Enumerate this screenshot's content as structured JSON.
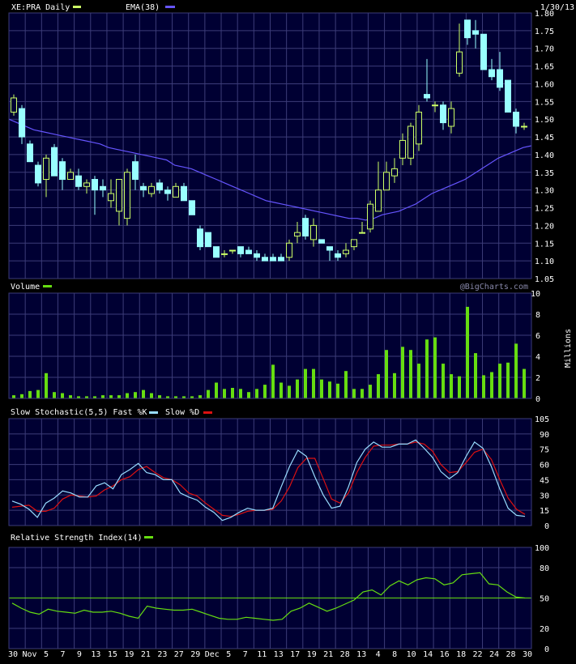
{
  "colors": {
    "background": "#000000",
    "panel": "#000033",
    "grid": "#3c3c78",
    "candle_up": "#ccff66",
    "candle_down": "#99ffff",
    "ema": "#6655ff",
    "volume": "#66dd11",
    "fast_k": "#99ddff",
    "slow_d": "#dd1111",
    "rsi": "#66dd11",
    "text": "#ffffff"
  },
  "header": {
    "symbol_label": "XE:PRA Daily",
    "ema_label": "EMA(38)",
    "date": "1/30/13"
  },
  "volume_panel": {
    "title": "Volume",
    "watermark": "@BigCharts.com",
    "unit": "Millions"
  },
  "stoch_panel": {
    "title": "Slow Stochastic(5,5) Fast %K",
    "slow_label": "Slow %D"
  },
  "rsi_panel": {
    "title": "Relative Strength Index(14)"
  },
  "x_axis": {
    "labels": [
      "30",
      "Nov",
      "5",
      "7",
      "9",
      "13",
      "15",
      "19",
      "21",
      "23",
      "27",
      "29",
      "Dec",
      "5",
      "7",
      "11",
      "13",
      "17",
      "19",
      "21",
      "28",
      "13",
      "4",
      "8",
      "10",
      "14",
      "16",
      "18",
      "22",
      "24",
      "28",
      "30"
    ]
  },
  "chart_data": [
    {
      "type": "candlestick",
      "ylim": [
        1.05,
        1.8
      ],
      "ytick_labels": [
        "1.80",
        "1.75",
        "1.70",
        "1.65",
        "1.60",
        "1.55",
        "1.50",
        "1.45",
        "1.40",
        "1.35",
        "1.30",
        "1.25",
        "1.20",
        "1.15",
        "1.10",
        "1.05"
      ],
      "ohlc": [
        [
          1.52,
          1.57,
          1.51,
          1.56
        ],
        [
          1.53,
          1.54,
          1.43,
          1.45
        ],
        [
          1.43,
          1.44,
          1.38,
          1.38
        ],
        [
          1.37,
          1.38,
          1.31,
          1.32
        ],
        [
          1.33,
          1.4,
          1.28,
          1.39
        ],
        [
          1.42,
          1.43,
          1.34,
          1.34
        ],
        [
          1.38,
          1.39,
          1.3,
          1.33
        ],
        [
          1.33,
          1.36,
          1.33,
          1.35
        ],
        [
          1.34,
          1.36,
          1.3,
          1.31
        ],
        [
          1.31,
          1.33,
          1.29,
          1.32
        ],
        [
          1.33,
          1.34,
          1.23,
          1.3
        ],
        [
          1.31,
          1.33,
          1.28,
          1.3
        ],
        [
          1.27,
          1.33,
          1.25,
          1.29
        ],
        [
          1.24,
          1.33,
          1.2,
          1.33
        ],
        [
          1.22,
          1.36,
          1.2,
          1.35
        ],
        [
          1.38,
          1.4,
          1.3,
          1.33
        ],
        [
          1.31,
          1.32,
          1.28,
          1.3
        ],
        [
          1.29,
          1.32,
          1.28,
          1.31
        ],
        [
          1.32,
          1.33,
          1.29,
          1.3
        ],
        [
          1.3,
          1.31,
          1.27,
          1.29
        ],
        [
          1.28,
          1.32,
          1.28,
          1.31
        ],
        [
          1.31,
          1.32,
          1.27,
          1.27
        ],
        [
          1.27,
          1.27,
          1.23,
          1.23
        ],
        [
          1.19,
          1.2,
          1.13,
          1.14
        ],
        [
          1.18,
          1.18,
          1.14,
          1.14
        ],
        [
          1.14,
          1.14,
          1.11,
          1.11
        ],
        [
          1.12,
          1.13,
          1.11,
          1.12
        ],
        [
          1.13,
          1.13,
          1.12,
          1.13
        ],
        [
          1.14,
          1.14,
          1.11,
          1.12
        ],
        [
          1.13,
          1.14,
          1.12,
          1.12
        ],
        [
          1.12,
          1.13,
          1.1,
          1.11
        ],
        [
          1.11,
          1.12,
          1.1,
          1.1
        ],
        [
          1.11,
          1.12,
          1.1,
          1.1
        ],
        [
          1.11,
          1.12,
          1.1,
          1.1
        ],
        [
          1.11,
          1.16,
          1.1,
          1.15
        ],
        [
          1.17,
          1.21,
          1.15,
          1.18
        ],
        [
          1.22,
          1.23,
          1.16,
          1.17
        ],
        [
          1.16,
          1.22,
          1.14,
          1.2
        ],
        [
          1.16,
          1.16,
          1.15,
          1.15
        ],
        [
          1.14,
          1.14,
          1.1,
          1.13
        ],
        [
          1.12,
          1.13,
          1.1,
          1.11
        ],
        [
          1.12,
          1.15,
          1.11,
          1.13
        ],
        [
          1.14,
          1.16,
          1.13,
          1.16
        ],
        [
          1.18,
          1.21,
          1.18,
          1.18
        ],
        [
          1.19,
          1.27,
          1.18,
          1.26
        ],
        [
          1.24,
          1.38,
          1.24,
          1.3
        ],
        [
          1.3,
          1.38,
          1.3,
          1.35
        ],
        [
          1.34,
          1.39,
          1.32,
          1.36
        ],
        [
          1.39,
          1.46,
          1.37,
          1.44
        ],
        [
          1.39,
          1.49,
          1.37,
          1.48
        ],
        [
          1.43,
          1.54,
          1.41,
          1.52
        ],
        [
          1.57,
          1.67,
          1.55,
          1.56
        ],
        [
          1.54,
          1.55,
          1.52,
          1.54
        ],
        [
          1.54,
          1.55,
          1.47,
          1.49
        ],
        [
          1.48,
          1.55,
          1.46,
          1.53
        ],
        [
          1.63,
          1.77,
          1.62,
          1.69
        ],
        [
          1.78,
          1.78,
          1.71,
          1.73
        ],
        [
          1.75,
          1.78,
          1.7,
          1.74
        ],
        [
          1.74,
          1.74,
          1.66,
          1.64
        ],
        [
          1.64,
          1.67,
          1.61,
          1.62
        ],
        [
          1.64,
          1.69,
          1.58,
          1.59
        ],
        [
          1.61,
          1.61,
          1.52,
          1.52
        ],
        [
          1.52,
          1.53,
          1.46,
          1.48
        ],
        [
          1.48,
          1.49,
          1.47,
          1.48
        ]
      ],
      "ema38": [
        1.5,
        1.49,
        1.48,
        1.47,
        1.465,
        1.46,
        1.455,
        1.45,
        1.445,
        1.44,
        1.435,
        1.43,
        1.42,
        1.415,
        1.41,
        1.405,
        1.4,
        1.395,
        1.39,
        1.385,
        1.37,
        1.365,
        1.36,
        1.35,
        1.34,
        1.33,
        1.32,
        1.31,
        1.3,
        1.29,
        1.28,
        1.27,
        1.265,
        1.26,
        1.255,
        1.25,
        1.245,
        1.24,
        1.235,
        1.23,
        1.225,
        1.22,
        1.22,
        1.215,
        1.22,
        1.23,
        1.235,
        1.24,
        1.25,
        1.26,
        1.275,
        1.29,
        1.3,
        1.31,
        1.32,
        1.33,
        1.345,
        1.36,
        1.375,
        1.39,
        1.4,
        1.41,
        1.42,
        1.425
      ]
    },
    {
      "type": "bar",
      "title": "Volume",
      "ylabel": "Millions",
      "ylim": [
        0,
        10
      ],
      "ytick_labels": [
        "10",
        "8",
        "6",
        "4",
        "2",
        "0"
      ],
      "values": [
        0.3,
        0.4,
        0.7,
        0.8,
        2.4,
        0.6,
        0.5,
        0.3,
        0.2,
        0.2,
        0.2,
        0.3,
        0.3,
        0.3,
        0.5,
        0.6,
        0.8,
        0.5,
        0.3,
        0.2,
        0.2,
        0.2,
        0.2,
        0.3,
        0.8,
        1.5,
        0.9,
        1.0,
        0.9,
        0.6,
        0.9,
        1.3,
        3.2,
        1.5,
        1.2,
        1.8,
        2.8,
        2.8,
        1.8,
        1.6,
        1.4,
        2.6,
        0.9,
        0.9,
        1.3,
        2.3,
        4.6,
        2.4,
        4.9,
        4.6,
        3.3,
        5.6,
        5.8,
        3.3,
        2.3,
        2.1,
        8.7,
        4.3,
        2.2,
        2.5,
        3.3,
        3.4,
        5.2,
        2.8
      ]
    },
    {
      "type": "line",
      "title": "Slow Stochastic(5,5)",
      "ylim": [
        0,
        105
      ],
      "ytick_labels": [
        "105",
        "90",
        "75",
        "60",
        "45",
        "30",
        "15",
        "0"
      ],
      "series": [
        {
          "name": "Fast %K",
          "values": [
            24,
            21,
            16,
            8,
            22,
            27,
            34,
            32,
            28,
            28,
            39,
            42,
            36,
            50,
            55,
            61,
            52,
            50,
            45,
            45,
            32,
            28,
            25,
            18,
            13,
            5,
            8,
            13,
            17,
            15,
            15,
            17,
            38,
            58,
            74,
            68,
            48,
            30,
            17,
            19,
            38,
            62,
            75,
            82,
            77,
            77,
            80,
            80,
            84,
            76,
            67,
            53,
            46,
            52,
            68,
            82,
            76,
            58,
            36,
            17,
            10,
            9
          ]
        },
        {
          "name": "Slow %D",
          "values": [
            18,
            19,
            20,
            14,
            14,
            17,
            26,
            30,
            29,
            28,
            29,
            35,
            39,
            45,
            48,
            55,
            58,
            52,
            47,
            45,
            40,
            32,
            29,
            22,
            16,
            10,
            9,
            11,
            14,
            15,
            15,
            16,
            24,
            38,
            57,
            66,
            66,
            46,
            26,
            22,
            32,
            52,
            67,
            78,
            79,
            79,
            80,
            80,
            82,
            80,
            73,
            60,
            52,
            53,
            62,
            72,
            75,
            65,
            45,
            27,
            16,
            11
          ]
        }
      ]
    },
    {
      "type": "line",
      "title": "Relative Strength Index(14)",
      "ylim": [
        0,
        100
      ],
      "ytick_labels": [
        "100",
        "80",
        "50",
        "20",
        "0"
      ],
      "reference_line": 50,
      "series": [
        {
          "name": "RSI(14)",
          "values": [
            45,
            40,
            36,
            34,
            39,
            37,
            36,
            35,
            38,
            36,
            36,
            37,
            35,
            32,
            30,
            42,
            40,
            39,
            38,
            38,
            39,
            36,
            33,
            30,
            29,
            29,
            31,
            30,
            29,
            28,
            29,
            37,
            40,
            45,
            41,
            37,
            40,
            44,
            48,
            56,
            58,
            53,
            62,
            67,
            63,
            68,
            70,
            69,
            63,
            65,
            73,
            74,
            75,
            64,
            63,
            56,
            51,
            50
          ]
        }
      ]
    }
  ]
}
